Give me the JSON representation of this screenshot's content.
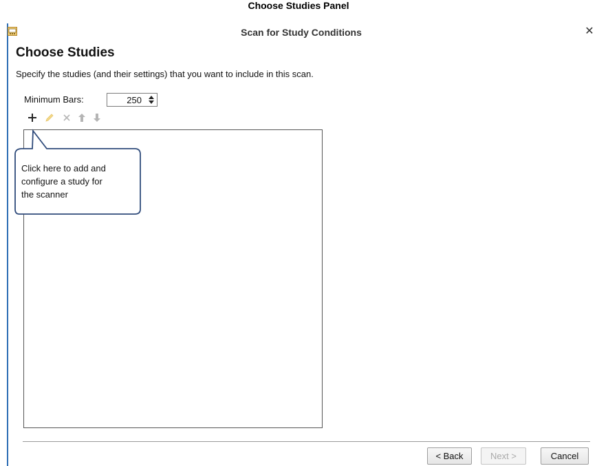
{
  "caption": "Choose Studies Panel",
  "window": {
    "title": "Scan for Study Conditions",
    "close_glyph": "✕",
    "icon": "app-scanner-icon",
    "accent_color": "#2d6db4"
  },
  "page": {
    "heading": "Choose Studies",
    "description": "Specify the studies (and their settings) that you want to include in this scan."
  },
  "minimum_bars": {
    "label": "Minimum Bars:",
    "value": "250"
  },
  "toolbar": {
    "add_icon": "plus-icon",
    "edit_icon": "pencil-icon",
    "remove_icon": "x-icon",
    "move_up_icon": "arrow-up-icon",
    "move_down_icon": "arrow-down-icon"
  },
  "callout": {
    "lines": [
      "Click here to add and",
      "configure a study for",
      "the scanner"
    ]
  },
  "footer": {
    "back_label": "< Back",
    "next_label": "Next >",
    "cancel_label": "Cancel"
  }
}
